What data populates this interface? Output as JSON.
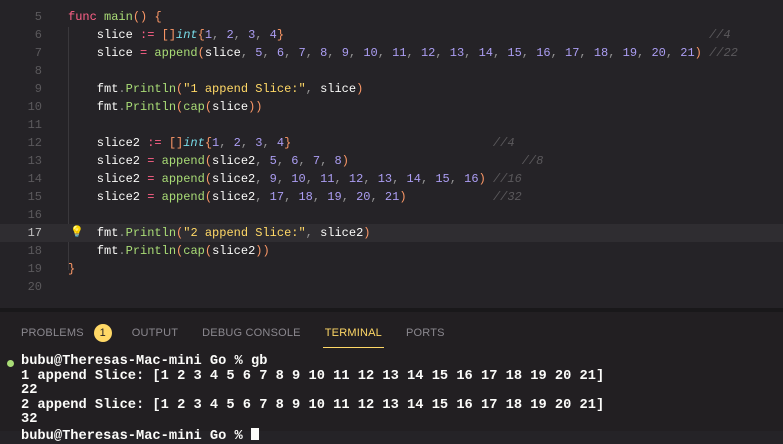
{
  "editor": {
    "active_line": 17,
    "lines": [
      {
        "n": "5",
        "t": [
          [
            "kw",
            "func"
          ],
          [
            "tx",
            " "
          ],
          [
            "fn",
            "main"
          ],
          [
            "br",
            "()"
          ],
          [
            "tx",
            " "
          ],
          [
            "br",
            "{"
          ]
        ]
      },
      {
        "n": "6",
        "t": [
          [
            "tx",
            "    slice "
          ],
          [
            "op",
            ":="
          ],
          [
            "tx",
            " "
          ],
          [
            "br",
            "[]"
          ],
          [
            "ty",
            "int"
          ],
          [
            "br",
            "{"
          ],
          [
            "n",
            "1"
          ],
          [
            "pu",
            ", "
          ],
          [
            "n",
            "2"
          ],
          [
            "pu",
            ", "
          ],
          [
            "n",
            "3"
          ],
          [
            "pu",
            ", "
          ],
          [
            "n",
            "4"
          ],
          [
            "br",
            "}"
          ],
          [
            "tx",
            "                                                           "
          ],
          [
            "cm",
            "//4"
          ]
        ]
      },
      {
        "n": "7",
        "t": [
          [
            "tx",
            "    slice "
          ],
          [
            "op",
            "="
          ],
          [
            "tx",
            " "
          ],
          [
            "fn",
            "append"
          ],
          [
            "br",
            "("
          ],
          [
            "tx",
            "slice"
          ],
          [
            "pu",
            ", "
          ],
          [
            "n",
            "5"
          ],
          [
            "pu",
            ", "
          ],
          [
            "n",
            "6"
          ],
          [
            "pu",
            ", "
          ],
          [
            "n",
            "7"
          ],
          [
            "pu",
            ", "
          ],
          [
            "n",
            "8"
          ],
          [
            "pu",
            ", "
          ],
          [
            "n",
            "9"
          ],
          [
            "pu",
            ", "
          ],
          [
            "n",
            "10"
          ],
          [
            "pu",
            ", "
          ],
          [
            "n",
            "11"
          ],
          [
            "pu",
            ", "
          ],
          [
            "n",
            "12"
          ],
          [
            "pu",
            ", "
          ],
          [
            "n",
            "13"
          ],
          [
            "pu",
            ", "
          ],
          [
            "n",
            "14"
          ],
          [
            "pu",
            ", "
          ],
          [
            "n",
            "15"
          ],
          [
            "pu",
            ", "
          ],
          [
            "n",
            "16"
          ],
          [
            "pu",
            ", "
          ],
          [
            "n",
            "17"
          ],
          [
            "pu",
            ", "
          ],
          [
            "n",
            "18"
          ],
          [
            "pu",
            ", "
          ],
          [
            "n",
            "19"
          ],
          [
            "pu",
            ", "
          ],
          [
            "n",
            "20"
          ],
          [
            "pu",
            ", "
          ],
          [
            "n",
            "21"
          ],
          [
            "br",
            ")"
          ],
          [
            "tx",
            " "
          ],
          [
            "cm",
            "//22"
          ]
        ]
      },
      {
        "n": "8",
        "t": []
      },
      {
        "n": "9",
        "t": [
          [
            "tx",
            "    fmt"
          ],
          [
            "pu",
            "."
          ],
          [
            "fn",
            "Println"
          ],
          [
            "br",
            "("
          ],
          [
            "st",
            "\"1 append Slice:\""
          ],
          [
            "pu",
            ", "
          ],
          [
            "tx",
            "slice"
          ],
          [
            "br",
            ")"
          ]
        ]
      },
      {
        "n": "10",
        "t": [
          [
            "tx",
            "    fmt"
          ],
          [
            "pu",
            "."
          ],
          [
            "fn",
            "Println"
          ],
          [
            "br",
            "("
          ],
          [
            "fn",
            "cap"
          ],
          [
            "br",
            "("
          ],
          [
            "tx",
            "slice"
          ],
          [
            "br",
            "))"
          ]
        ]
      },
      {
        "n": "11",
        "t": []
      },
      {
        "n": "12",
        "t": [
          [
            "tx",
            "    slice2 "
          ],
          [
            "op",
            ":="
          ],
          [
            "tx",
            " "
          ],
          [
            "br",
            "[]"
          ],
          [
            "ty",
            "int"
          ],
          [
            "br",
            "{"
          ],
          [
            "n",
            "1"
          ],
          [
            "pu",
            ", "
          ],
          [
            "n",
            "2"
          ],
          [
            "pu",
            ", "
          ],
          [
            "n",
            "3"
          ],
          [
            "pu",
            ", "
          ],
          [
            "n",
            "4"
          ],
          [
            "br",
            "}"
          ],
          [
            "tx",
            "                            "
          ],
          [
            "cm",
            "//4"
          ]
        ]
      },
      {
        "n": "13",
        "t": [
          [
            "tx",
            "    slice2 "
          ],
          [
            "op",
            "="
          ],
          [
            "tx",
            " "
          ],
          [
            "fn",
            "append"
          ],
          [
            "br",
            "("
          ],
          [
            "tx",
            "slice2"
          ],
          [
            "pu",
            ", "
          ],
          [
            "n",
            "5"
          ],
          [
            "pu",
            ", "
          ],
          [
            "n",
            "6"
          ],
          [
            "pu",
            ", "
          ],
          [
            "n",
            "7"
          ],
          [
            "pu",
            ", "
          ],
          [
            "n",
            "8"
          ],
          [
            "br",
            ")"
          ],
          [
            "tx",
            "                        "
          ],
          [
            "cm",
            "//8"
          ]
        ]
      },
      {
        "n": "14",
        "t": [
          [
            "tx",
            "    slice2 "
          ],
          [
            "op",
            "="
          ],
          [
            "tx",
            " "
          ],
          [
            "fn",
            "append"
          ],
          [
            "br",
            "("
          ],
          [
            "tx",
            "slice2"
          ],
          [
            "pu",
            ", "
          ],
          [
            "n",
            "9"
          ],
          [
            "pu",
            ", "
          ],
          [
            "n",
            "10"
          ],
          [
            "pu",
            ", "
          ],
          [
            "n",
            "11"
          ],
          [
            "pu",
            ", "
          ],
          [
            "n",
            "12"
          ],
          [
            "pu",
            ", "
          ],
          [
            "n",
            "13"
          ],
          [
            "pu",
            ", "
          ],
          [
            "n",
            "14"
          ],
          [
            "pu",
            ", "
          ],
          [
            "n",
            "15"
          ],
          [
            "pu",
            ", "
          ],
          [
            "n",
            "16"
          ],
          [
            "br",
            ")"
          ],
          [
            "tx",
            " "
          ],
          [
            "cm",
            "//16"
          ]
        ]
      },
      {
        "n": "15",
        "t": [
          [
            "tx",
            "    slice2 "
          ],
          [
            "op",
            "="
          ],
          [
            "tx",
            " "
          ],
          [
            "fn",
            "append"
          ],
          [
            "br",
            "("
          ],
          [
            "tx",
            "slice2"
          ],
          [
            "pu",
            ", "
          ],
          [
            "n",
            "17"
          ],
          [
            "pu",
            ", "
          ],
          [
            "n",
            "18"
          ],
          [
            "pu",
            ", "
          ],
          [
            "n",
            "19"
          ],
          [
            "pu",
            ", "
          ],
          [
            "n",
            "20"
          ],
          [
            "pu",
            ", "
          ],
          [
            "n",
            "21"
          ],
          [
            "br",
            ")"
          ],
          [
            "tx",
            "            "
          ],
          [
            "cm",
            "//32"
          ]
        ]
      },
      {
        "n": "16",
        "t": []
      },
      {
        "n": "17",
        "t": [
          [
            "tx",
            "    fmt"
          ],
          [
            "pu",
            "."
          ],
          [
            "fn",
            "Println"
          ],
          [
            "br",
            "("
          ],
          [
            "st",
            "\"2 append Slice:\""
          ],
          [
            "pu",
            ", "
          ],
          [
            "tx",
            "slice2"
          ],
          [
            "br",
            ")"
          ]
        ]
      },
      {
        "n": "18",
        "t": [
          [
            "tx",
            "    fmt"
          ],
          [
            "pu",
            "."
          ],
          [
            "fn",
            "Println"
          ],
          [
            "br",
            "("
          ],
          [
            "fn",
            "cap"
          ],
          [
            "br",
            "("
          ],
          [
            "tx",
            "slice2"
          ],
          [
            "br",
            "))"
          ]
        ]
      },
      {
        "n": "19",
        "t": [
          [
            "br",
            "}"
          ]
        ]
      },
      {
        "n": "20",
        "t": []
      }
    ],
    "lightbulb_icon": "lightbulb-icon"
  },
  "panel": {
    "tabs": [
      {
        "label": "PROBLEMS",
        "badge": "1"
      },
      {
        "label": "OUTPUT"
      },
      {
        "label": "DEBUG CONSOLE"
      },
      {
        "label": "TERMINAL",
        "active": true
      },
      {
        "label": "PORTS"
      }
    ],
    "terminal": {
      "lines": [
        "bubu@Theresas-Mac-mini Go % gb",
        "1 append Slice: [1 2 3 4 5 6 7 8 9 10 11 12 13 14 15 16 17 18 19 20 21]",
        "22",
        "2 append Slice: [1 2 3 4 5 6 7 8 9 10 11 12 13 14 15 16 17 18 19 20 21]",
        "32"
      ],
      "prompt": "bubu@Theresas-Mac-mini Go % "
    }
  },
  "colors": {
    "background": "#252327",
    "keyword": "#ff6188",
    "function": "#a9dc76",
    "number": "#ab9df2",
    "string": "#ffd866",
    "accent": "#ffd866"
  }
}
